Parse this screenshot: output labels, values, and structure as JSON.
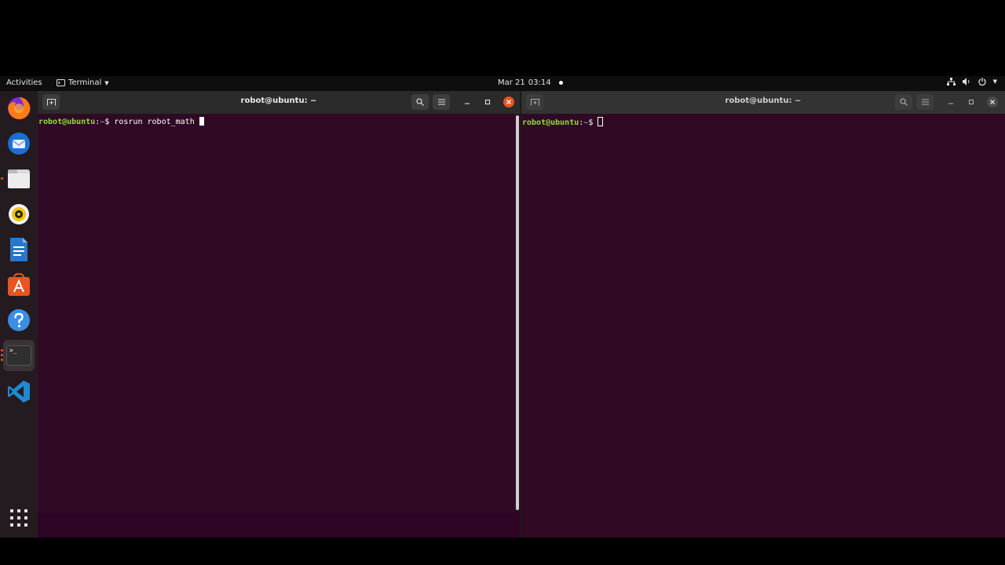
{
  "topbar": {
    "activities": "Activities",
    "app_menu": "Terminal",
    "date": "Mar 21",
    "time": "03:14"
  },
  "dock": {
    "items": [
      {
        "name": "firefox"
      },
      {
        "name": "thunderbird"
      },
      {
        "name": "files"
      },
      {
        "name": "rhythmbox"
      },
      {
        "name": "libreoffice-writer"
      },
      {
        "name": "software-center"
      },
      {
        "name": "help"
      },
      {
        "name": "terminal",
        "glyph": ">_"
      },
      {
        "name": "vscode"
      },
      {
        "name": "show-apps"
      }
    ]
  },
  "windows": {
    "left": {
      "title": "robot@ubuntu: ~",
      "prompt_user": "robot@ubuntu",
      "prompt_sep": ":",
      "prompt_path": "~",
      "prompt_symbol": "$ ",
      "command": "rosrun robot_math "
    },
    "right": {
      "title": "robot@ubuntu: ~",
      "prompt_user": "robot@ubuntu",
      "prompt_sep": ":",
      "prompt_path": "~",
      "prompt_symbol": "$ ",
      "command": ""
    }
  },
  "colors": {
    "terminal_bg": "#300a24",
    "prompt_user": "#8ae234",
    "prompt_path": "#729fcf",
    "accent": "#e95420"
  }
}
